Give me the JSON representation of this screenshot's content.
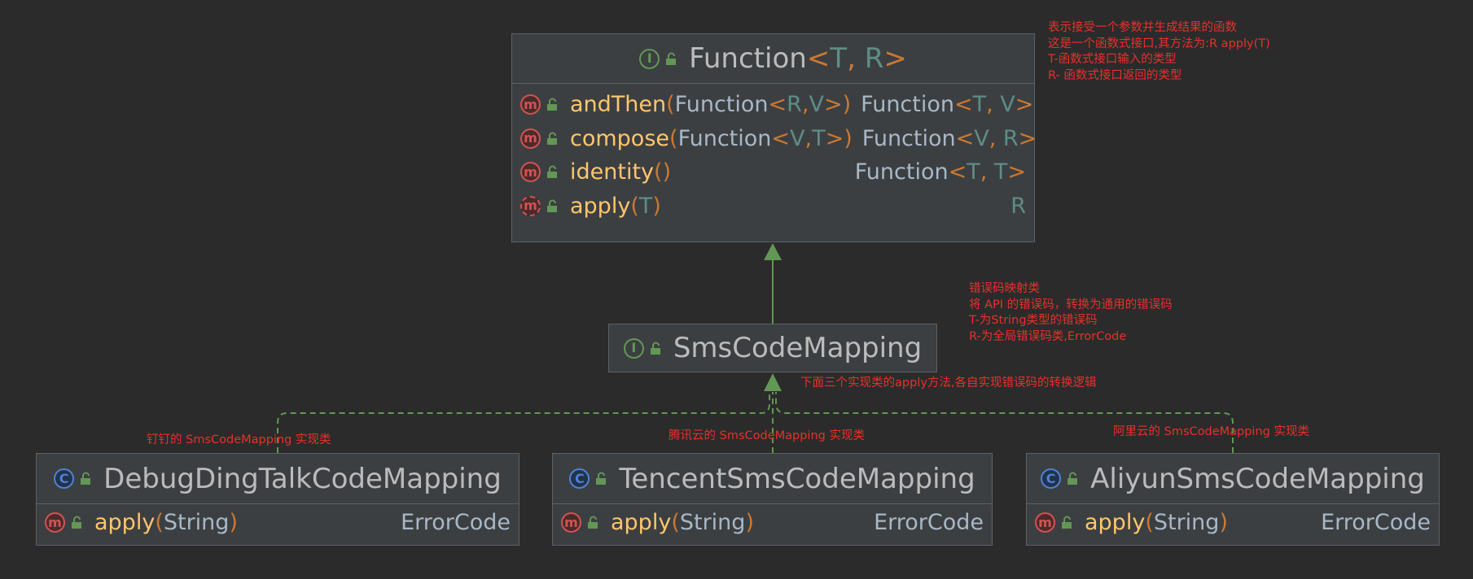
{
  "colors": {
    "background": "#2b2b2b",
    "node_fill": "#3c3f41",
    "node_border": "#5e6165",
    "edge": "#629755",
    "annotation": "#e8302b",
    "method_name": "#ffc66d",
    "type_param": "#5f8c86",
    "punctuation": "#cc7832"
  },
  "icons": {
    "interface": "interface-icon",
    "class": "class-icon",
    "method": "method-icon",
    "abstract_method": "abstract-method-icon",
    "visibility": "public-lock-icon"
  },
  "nodes": {
    "function": {
      "kind": "interface",
      "name": "Function",
      "type_params": [
        "T",
        "R"
      ],
      "methods": [
        {
          "name": "andThen",
          "abstract": false,
          "params": [
            {
              "t": "Function"
            },
            {
              "t": "<"
            },
            {
              "t": "R",
              "tp": true
            },
            {
              "t": ", "
            },
            {
              "t": "V",
              "tp": true
            },
            {
              "t": ">"
            }
          ],
          "ret": [
            {
              "t": "Function"
            },
            {
              "t": "<"
            },
            {
              "t": "T",
              "tp": true
            },
            {
              "t": ", "
            },
            {
              "t": "V",
              "tp": true
            },
            {
              "t": ">"
            }
          ]
        },
        {
          "name": "compose",
          "abstract": false,
          "params": [
            {
              "t": "Function"
            },
            {
              "t": "<"
            },
            {
              "t": "V",
              "tp": true
            },
            {
              "t": ", "
            },
            {
              "t": "T",
              "tp": true
            },
            {
              "t": ">"
            }
          ],
          "ret": [
            {
              "t": "Function"
            },
            {
              "t": "<"
            },
            {
              "t": "V",
              "tp": true
            },
            {
              "t": ", "
            },
            {
              "t": "R",
              "tp": true
            },
            {
              "t": ">"
            }
          ]
        },
        {
          "name": "identity",
          "abstract": false,
          "params": [],
          "ret": [
            {
              "t": "Function"
            },
            {
              "t": "<"
            },
            {
              "t": "T",
              "tp": true
            },
            {
              "t": ", "
            },
            {
              "t": "T",
              "tp": true
            },
            {
              "t": ">"
            }
          ]
        },
        {
          "name": "apply",
          "abstract": true,
          "params": [
            {
              "t": "T",
              "tp": true
            }
          ],
          "ret": [
            {
              "t": "R",
              "tp": true
            }
          ]
        }
      ]
    },
    "sms_code_mapping": {
      "kind": "interface",
      "name": "SmsCodeMapping"
    },
    "debug": {
      "kind": "class",
      "name": "DebugDingTalkCodeMapping",
      "methods": [
        {
          "name": "apply",
          "abstract": false,
          "params": [
            {
              "t": "String"
            }
          ],
          "ret": [
            {
              "t": "ErrorCode"
            }
          ]
        }
      ]
    },
    "tencent": {
      "kind": "class",
      "name": "TencentSmsCodeMapping",
      "methods": [
        {
          "name": "apply",
          "abstract": false,
          "params": [
            {
              "t": "String"
            }
          ],
          "ret": [
            {
              "t": "ErrorCode"
            }
          ]
        }
      ]
    },
    "aliyun": {
      "kind": "class",
      "name": "AliyunSmsCodeMapping",
      "methods": [
        {
          "name": "apply",
          "abstract": false,
          "params": [
            {
              "t": "String"
            }
          ],
          "ret": [
            {
              "t": "ErrorCode"
            }
          ]
        }
      ]
    }
  },
  "edges": [
    {
      "from": "sms_code_mapping",
      "to": "function",
      "kind": "extends"
    },
    {
      "from": "debug",
      "to": "sms_code_mapping",
      "kind": "implements"
    },
    {
      "from": "tencent",
      "to": "sms_code_mapping",
      "kind": "implements"
    },
    {
      "from": "aliyun",
      "to": "sms_code_mapping",
      "kind": "implements"
    }
  ],
  "annotations": {
    "function_note": {
      "lines": [
        "表示接受一个参数并生成结果的函数",
        "这是一个函数式接口,其方法为:R apply(T)",
        "T-函数式接口输入的类型",
        "R- 函数式接口返回的类型"
      ]
    },
    "sms_note": {
      "lines": [
        "错误码映射类",
        "将 API 的错误码，转换为通用的错误码",
        "T-为String类型的错误码",
        "R-为全局错误码类,ErrorCode"
      ]
    },
    "impl_note": {
      "text": "下面三个实现类的apply方法,各自实现错误码的转换逻辑"
    },
    "debug_note": {
      "text": "钉钉的 SmsCodeMapping 实现类"
    },
    "tencent_note": {
      "text": "腾讯云的 SmsCodeMapping 实现类"
    },
    "aliyun_note": {
      "text": "阿里云的 SmsCodeMapping 实现类"
    }
  }
}
